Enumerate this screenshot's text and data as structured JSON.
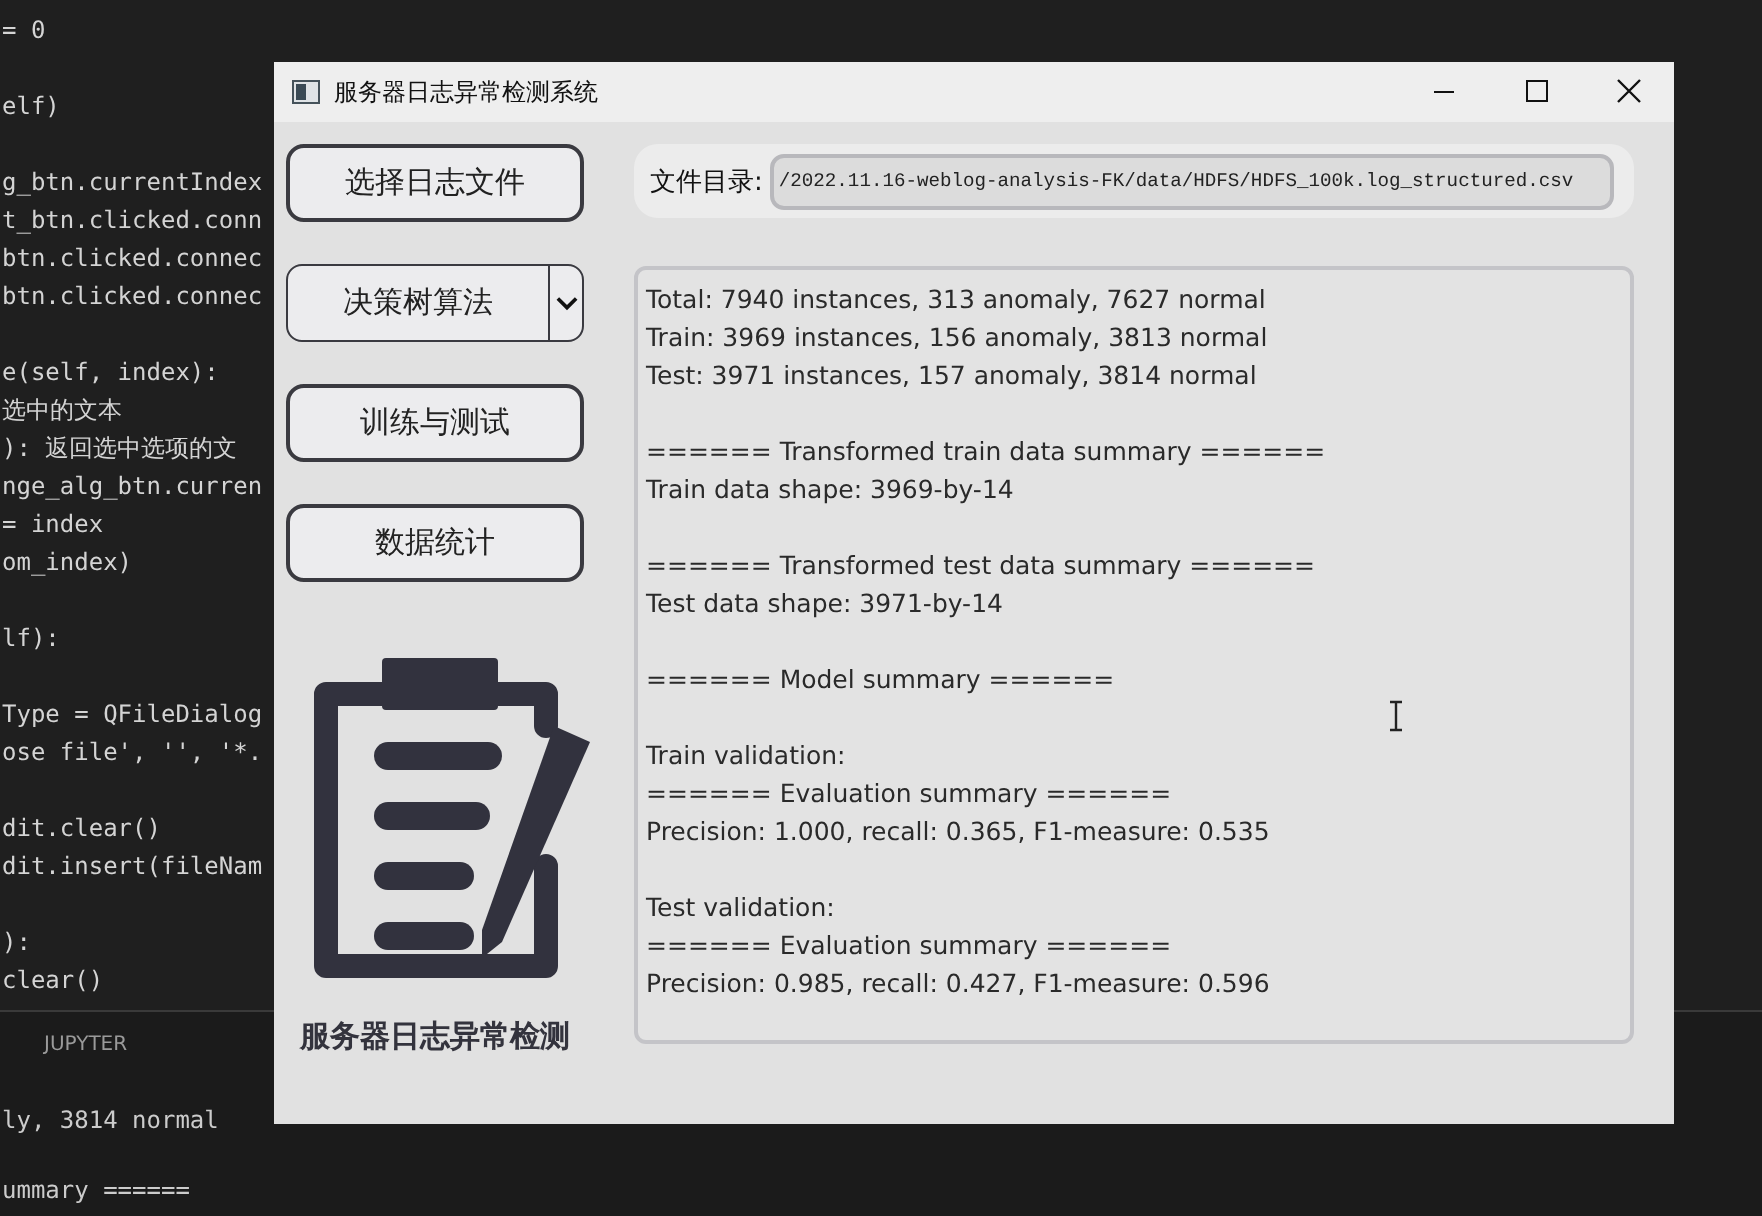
{
  "editor": {
    "code_blocks": [
      [
        "= 0"
      ],
      [
        "elf)"
      ],
      [
        "g_btn.currentIndex",
        "t_btn.clicked.conn",
        "btn.clicked.connec",
        "btn.clicked.connec"
      ],
      [
        "e(self, index):",
        "选中的文本",
        "): 返回选中选项的文",
        "nge_alg_btn.curren",
        "= index",
        "om_index)"
      ],
      [
        "lf):"
      ],
      [
        "Type = QFileDialog",
        "ose file', '', '*."
      ],
      [
        "dit.clear()",
        "dit.insert(fileNam"
      ],
      [
        "):",
        "clear()"
      ]
    ],
    "panel_tab": "JUPYTER",
    "output_blocks": [
      [
        "ly, 3814 normal"
      ],
      [
        "ummary ======"
      ]
    ]
  },
  "window": {
    "title": "服务器日志异常检测系统"
  },
  "buttons": [
    {
      "kind": "button",
      "label": "选择日志文件"
    },
    {
      "kind": "combo",
      "label": "决策树算法"
    },
    {
      "kind": "button",
      "label": "训练与测试"
    },
    {
      "kind": "button",
      "label": "数据统计"
    }
  ],
  "logo_caption": "服务器日志异常检测",
  "file_path": {
    "label": "文件目录:",
    "value": "/2022.11.16-weblog-analysis-FK/data/HDFS/HDFS_100k.log_structured.csv"
  },
  "output": [
    [
      "Total: 7940 instances, 313 anomaly, 7627 normal",
      "Train: 3969 instances, 156 anomaly, 3813 normal",
      "Test: 3971 instances, 157 anomaly, 3814 normal"
    ],
    [
      "====== Transformed train data summary ======",
      "Train data shape: 3969-by-14"
    ],
    [
      "====== Transformed test data summary ======",
      "Test data shape: 3971-by-14"
    ],
    [
      "====== Model summary ======"
    ],
    [
      "Train validation:",
      "====== Evaluation summary ======",
      "Precision: 1.000, recall: 0.365, F1-measure: 0.535"
    ],
    [
      "Test validation:",
      "====== Evaluation summary ======",
      "Precision: 0.985, recall: 0.427, F1-measure: 0.596"
    ]
  ]
}
